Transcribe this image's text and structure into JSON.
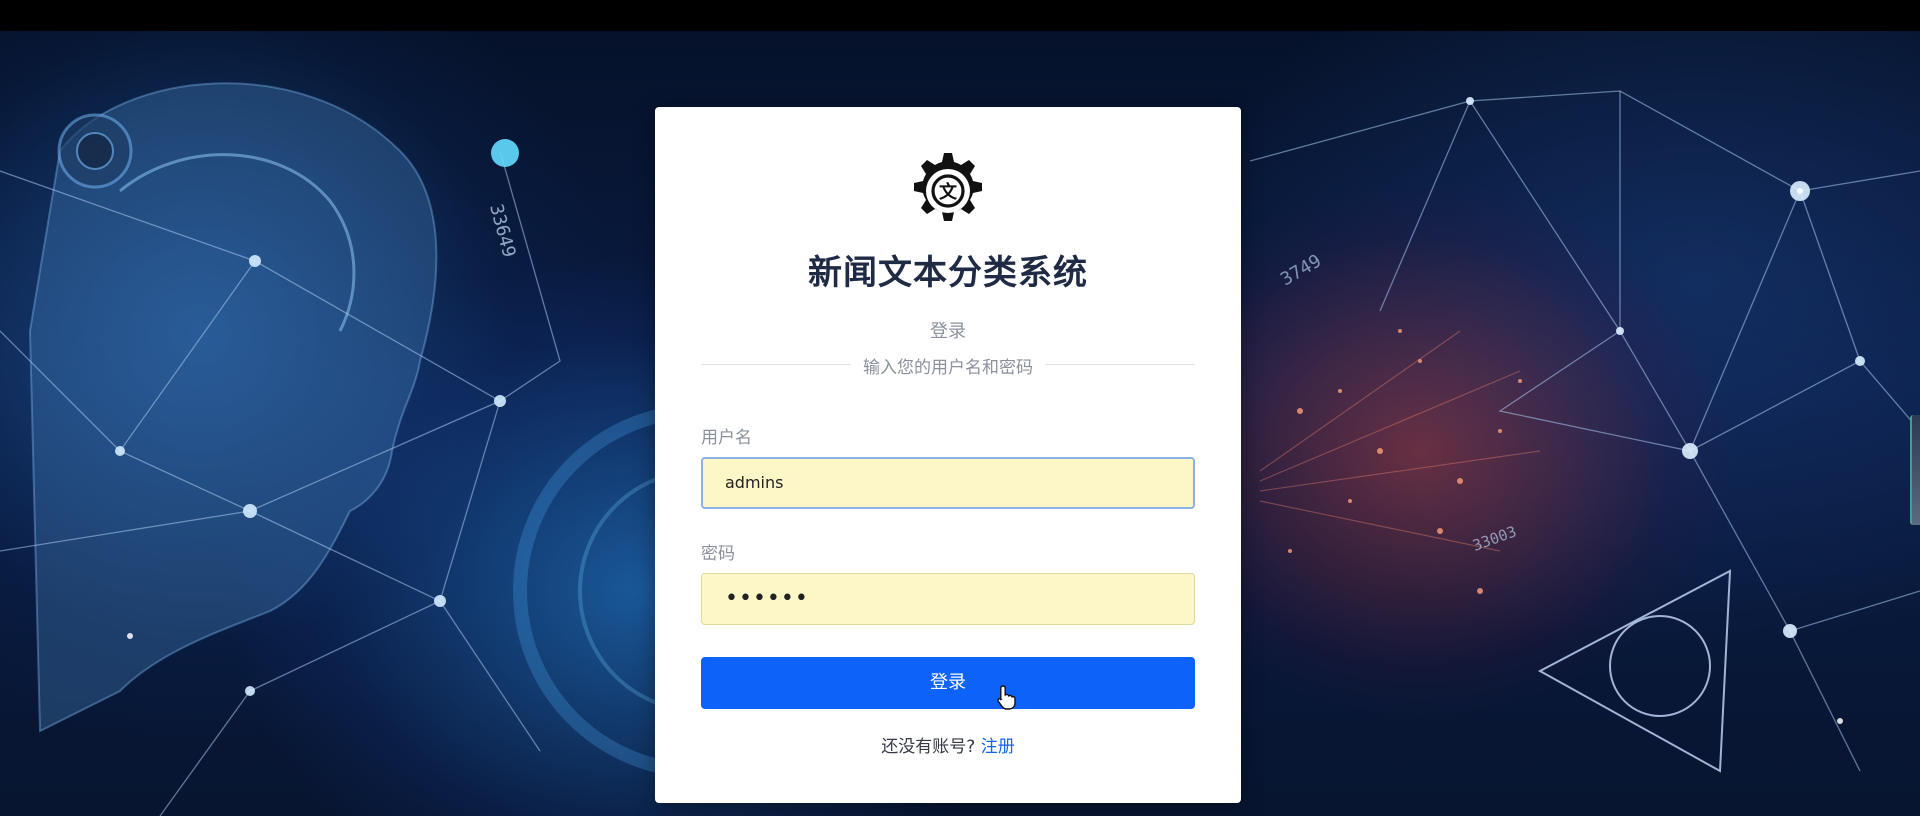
{
  "app": {
    "title": "新闻文本分类系统",
    "subtitle": "登录",
    "divider_text": "输入您的用户名和密码",
    "logo_icon": "gear-translate-icon"
  },
  "form": {
    "username_label": "用户名",
    "username_value": "admins",
    "password_label": "密码",
    "password_mask": "••••••",
    "login_button": "登录"
  },
  "footer": {
    "prompt": "还没有账号?",
    "register_link": "注册"
  },
  "colors": {
    "primary": "#0d63f9",
    "link": "#1466e8",
    "autofill": "#fdf7c7",
    "title": "#1f2a44"
  }
}
